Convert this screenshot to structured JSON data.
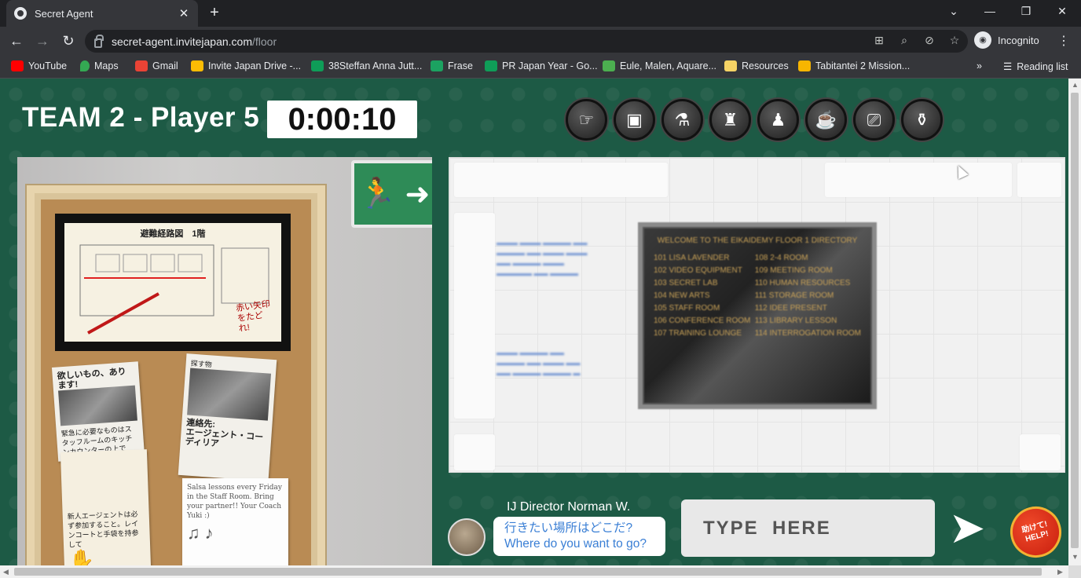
{
  "browser": {
    "tab_title": "Secret Agent",
    "tab_close": "✕",
    "new_tab": "+",
    "url_host": "secret-agent.invitejapan.com",
    "url_path": "/floor",
    "profile_label": "Incognito",
    "window_controls": [
      "⌄",
      "—",
      "❐",
      "✕"
    ],
    "bookmarks": [
      {
        "label": "YouTube",
        "color": "#ff0000"
      },
      {
        "label": "Maps",
        "color": "#34a853"
      },
      {
        "label": "Gmail",
        "color": "#ea4335"
      },
      {
        "label": "Invite Japan Drive -...",
        "color": "#fbbc04"
      },
      {
        "label": "38Steffan Anna Jutt...",
        "color": "#0f9d58"
      },
      {
        "label": "Frase",
        "color": "#1ca261"
      },
      {
        "label": "PR Japan Year - Go...",
        "color": "#0f9d58"
      },
      {
        "label": "Eule, Malen, Aquare...",
        "color": "#4caf50"
      },
      {
        "label": "Resources",
        "color": "#f6d365"
      },
      {
        "label": "Tabitantei 2 Mission...",
        "color": "#f7b500"
      }
    ],
    "overflow": "»",
    "reading_list": "Reading list"
  },
  "game": {
    "player_title": "TEAM 2 - Player 5",
    "timer": "0:00:10",
    "room_icons": [
      "directions-icon",
      "filmstrip-icon",
      "lab-icon",
      "paris-icon",
      "agent-icon",
      "cafe-icon",
      "camera-icon",
      "spray-icon"
    ]
  },
  "scene": {
    "map_title": "避難経路図　1階",
    "map_note": "赤い矢印をたどれ!",
    "note1": "欲しいもの、あります!",
    "note1_body": "緊急に必要なものはスタッフルームのキッチンカウンターの上です。心当たりのある方は、エージェント・フレアにご連絡ください。",
    "note2_head": "探す物",
    "note2_title": "連絡先:\nエージェント・コーディリア",
    "note3": "新人エージェントは必ず参加すること。レインコートと手袋を持参して",
    "note4": "Salsa lessons every Friday in the Staff Room. Bring your partner!! Your Coach Yuki :)"
  },
  "directory": {
    "title": "WELCOME TO THE EIKAIDEMY FLOOR 1 DIRECTORY",
    "left": [
      "101 LISA LAVENDER",
      "102 VIDEO EQUIPMENT",
      "103 SECRET LAB",
      "104 NEW ARTS",
      "105 STAFF ROOM",
      "106 CONFERENCE ROOM",
      "107 TRAINING LOUNGE"
    ],
    "right": [
      "108 2-4 ROOM",
      "109 MEETING ROOM",
      "110 HUMAN RESOURCES",
      "111 STORAGE ROOM",
      "112 IDEE PRESENT",
      "113 LIBRARY LESSON",
      "114 INTERROGATION ROOM"
    ]
  },
  "chat": {
    "director_name": "IJ Director Norman W.",
    "question_jp": "行きたい場所はどこだ?",
    "question_en": "Where do you want to go?",
    "input_placeholder": "TYPE  HERE",
    "help_label": "助けて!\nHELP!"
  }
}
